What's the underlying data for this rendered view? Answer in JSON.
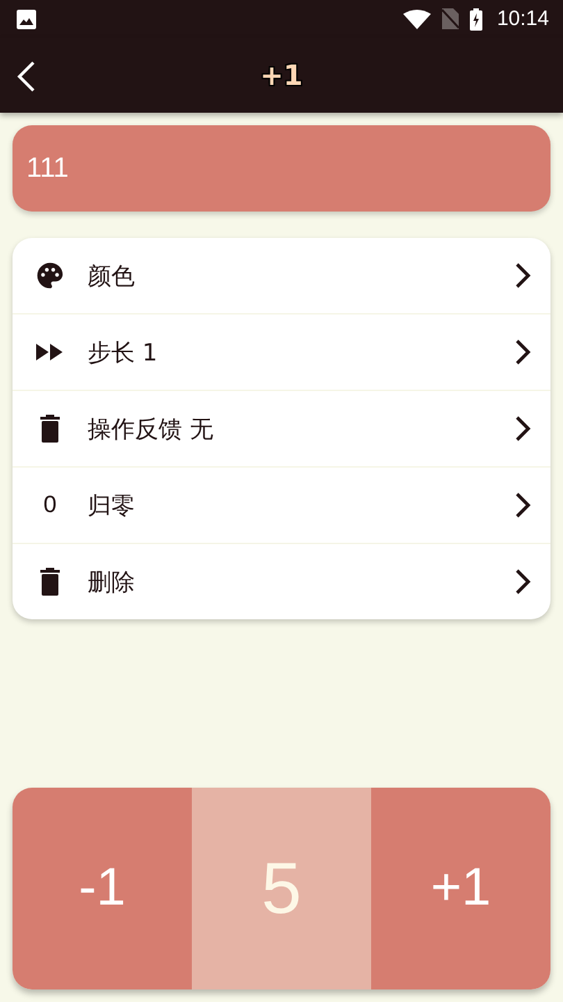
{
  "status_bar": {
    "time": "10:14"
  },
  "app_bar": {
    "title": "+1"
  },
  "counter_name": "111",
  "menu": [
    {
      "kind": "palette",
      "label": "颜色"
    },
    {
      "kind": "forward",
      "label": "步长 1"
    },
    {
      "kind": "trash",
      "label": "操作反馈 无"
    },
    {
      "kind": "glyph",
      "glyph": "0",
      "label": "归零"
    },
    {
      "kind": "trash",
      "label": "删除"
    }
  ],
  "counter": {
    "minus": "-1",
    "value": "5",
    "plus": "+1"
  }
}
